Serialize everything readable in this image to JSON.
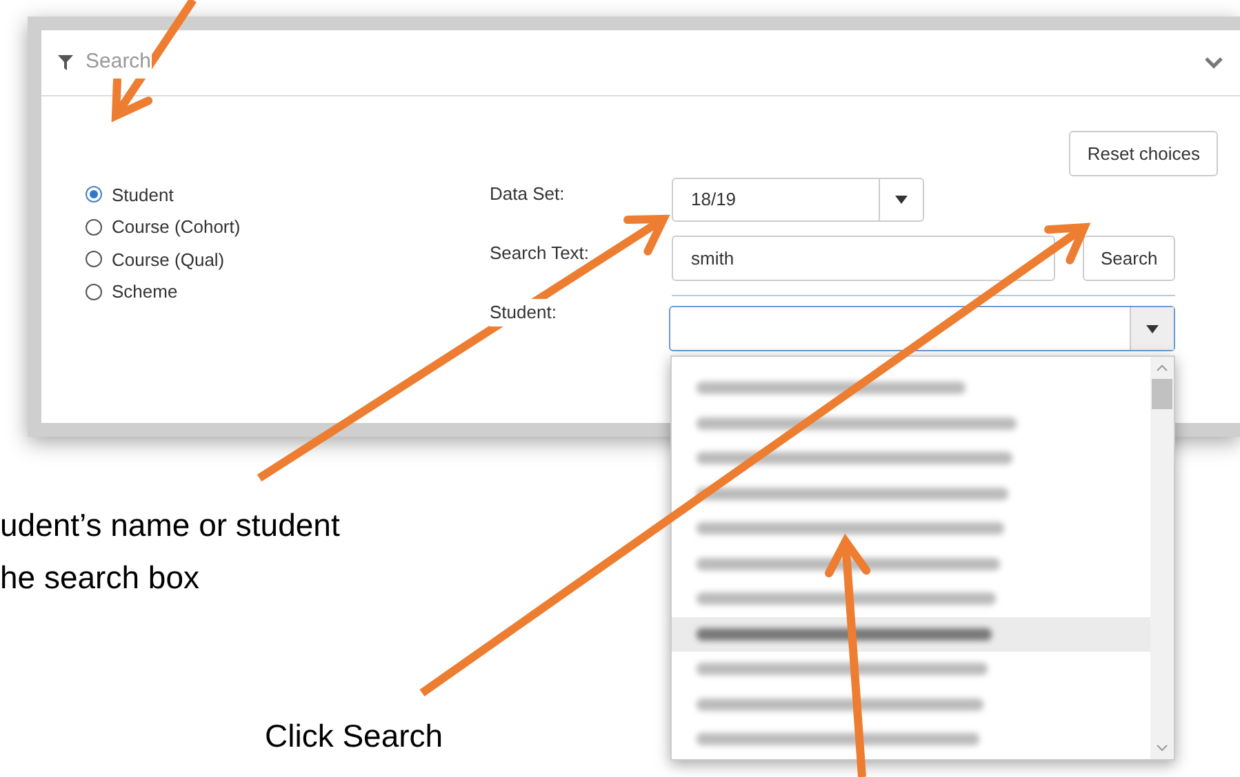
{
  "panel": {
    "title": "Search",
    "expanded": true
  },
  "search_types": [
    {
      "label": "Student",
      "selected": true
    },
    {
      "label": "Course (Cohort)",
      "selected": false
    },
    {
      "label": "Course (Qual)",
      "selected": false
    },
    {
      "label": "Scheme",
      "selected": false
    }
  ],
  "fields": {
    "data_set": {
      "label": "Data Set:",
      "value": "18/19"
    },
    "search_text": {
      "label": "Search Text:",
      "value": "smith"
    },
    "student": {
      "label": "Student:"
    }
  },
  "buttons": {
    "reset": "Reset choices",
    "search": "Search"
  },
  "student_options": [
    {
      "selected": false
    },
    {
      "selected": false
    },
    {
      "selected": false
    },
    {
      "selected": false
    },
    {
      "selected": false
    },
    {
      "selected": false
    },
    {
      "selected": false
    },
    {
      "selected": true
    },
    {
      "selected": false
    },
    {
      "selected": false
    },
    {
      "selected": false
    }
  ],
  "annotations": [
    {
      "text": "udent’s name or student"
    },
    {
      "text": "he search box"
    },
    {
      "text": "Click Search"
    }
  ]
}
